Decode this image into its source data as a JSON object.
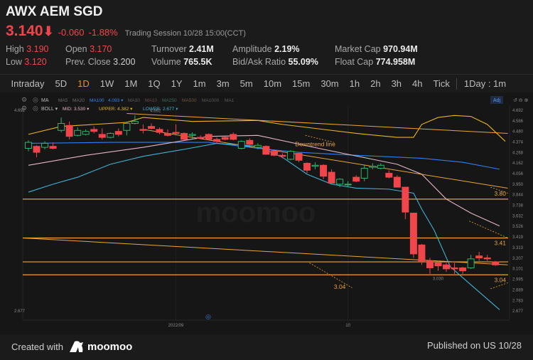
{
  "header": {
    "title": "AWX AEM SGD",
    "price": "3.140",
    "price_arrow_icon": "arrow-down-icon",
    "change": "-0.060",
    "change_pct": "-1.88%",
    "session": "Trading Session  10/28 15:00(CCT)"
  },
  "stats": {
    "high_label": "High",
    "high": "3.190",
    "low_label": "Low",
    "low": "3.120",
    "open_label": "Open",
    "open": "3.170",
    "prev_close_label": "Prev. Close",
    "prev_close": "3.200",
    "turnover_label": "Turnover",
    "turnover": "2.41M",
    "volume_label": "Volume",
    "volume": "765.5K",
    "amplitude_label": "Amplitude",
    "amplitude": "2.19%",
    "bidask_label": "Bid/Ask Ratio",
    "bidask": "55.09%",
    "mktcap_label": "Market Cap",
    "mktcap": "970.94M",
    "floatcap_label": "Float Cap",
    "floatcap": "774.958M"
  },
  "toolbar": {
    "tabs": [
      "Intraday",
      "5D",
      "1D",
      "1W",
      "1M",
      "1Q",
      "1Y",
      "1m",
      "3m",
      "5m",
      "10m",
      "15m",
      "30m",
      "1h",
      "2h",
      "3h",
      "4h",
      "Tick"
    ],
    "active": "1D",
    "interval": "1Day : 1m"
  },
  "indicators": {
    "ma_label": "MA",
    "ma_items": [
      {
        "label": "MA5",
        "color": "#6b6b6b"
      },
      {
        "label": "MA20",
        "color": "#6b6b6b"
      },
      {
        "label": "MA100",
        "color": "#2f86f0",
        "value": "4.093"
      },
      {
        "label": "MA30",
        "color": "#5a5a5a"
      },
      {
        "label": "MA10",
        "color": "#6a4a4a"
      },
      {
        "label": "MA250",
        "color": "#3a6a5a"
      },
      {
        "label": "MA500",
        "color": "#6a5a3a"
      },
      {
        "label": "MA1000",
        "color": "#5a5a5a"
      },
      {
        "label": "MA1",
        "color": "#5a5a5a"
      }
    ],
    "boll_label": "BOLL",
    "mid_label": "MID:",
    "mid": "3.530",
    "upper_label": "UPPER:",
    "upper": "4.382",
    "lower_label": "LOWER:",
    "lower": "2.677",
    "adj_label": "Adj"
  },
  "chart_data": {
    "type": "candlestick",
    "y_ticks": [
      "4.692",
      "4.586",
      "4.480",
      "4.374",
      "4.268",
      "4.162",
      "4.056",
      "3.950",
      "3.844",
      "3.738",
      "3.632",
      "3.526",
      "3.419",
      "3.313",
      "3.207",
      "3.101",
      "2.995",
      "2.889",
      "2.783",
      "2.677"
    ],
    "ylim": [
      2.677,
      4.692
    ],
    "x_labels": [
      {
        "bar": 18,
        "label": "2022/09"
      },
      {
        "bar": 39,
        "label": "10"
      }
    ],
    "colors": {
      "up": "#2fb36b",
      "down": "#f0454a",
      "upper": "#e6b422",
      "mid": "#e3b6c8",
      "lower": "#3fb2d4",
      "ma100": "#2f7ff0",
      "drawing": "#e8a33c"
    },
    "candles": [
      [
        4.31,
        4.39,
        4.28,
        4.37
      ],
      [
        4.33,
        4.34,
        4.22,
        4.27
      ],
      [
        4.32,
        4.38,
        4.3,
        4.36
      ],
      [
        4.33,
        4.37,
        4.3,
        4.31
      ],
      [
        4.49,
        4.62,
        4.47,
        4.56
      ],
      [
        4.54,
        4.58,
        4.4,
        4.43
      ],
      [
        4.44,
        4.52,
        4.43,
        4.49
      ],
      [
        4.45,
        4.5,
        4.44,
        4.48
      ],
      [
        4.5,
        4.53,
        4.46,
        4.48
      ],
      [
        4.45,
        4.51,
        4.4,
        4.42
      ],
      [
        4.42,
        4.47,
        4.41,
        4.46
      ],
      [
        4.48,
        4.51,
        4.43,
        4.45
      ],
      [
        4.49,
        4.58,
        4.44,
        4.56
      ],
      [
        4.56,
        4.64,
        4.55,
        4.58
      ],
      [
        4.5,
        4.55,
        4.46,
        4.49
      ],
      [
        4.53,
        4.56,
        4.5,
        4.51
      ],
      [
        4.5,
        4.52,
        4.45,
        4.47
      ],
      [
        4.46,
        4.5,
        4.43,
        4.44
      ],
      [
        4.47,
        4.55,
        4.44,
        4.46
      ],
      [
        4.46,
        4.47,
        4.39,
        4.4
      ],
      [
        4.44,
        4.47,
        4.4,
        4.45
      ],
      [
        4.42,
        4.44,
        4.4,
        4.41
      ],
      [
        4.45,
        4.46,
        4.39,
        4.4
      ],
      [
        4.4,
        4.42,
        4.36,
        4.38
      ],
      [
        4.42,
        4.43,
        4.39,
        4.4
      ],
      [
        4.45,
        4.47,
        4.39,
        4.4
      ],
      [
        4.31,
        4.39,
        4.3,
        4.38
      ],
      [
        4.39,
        4.41,
        4.34,
        4.35
      ],
      [
        4.32,
        4.36,
        4.3,
        4.34
      ],
      [
        4.33,
        4.34,
        4.25,
        4.25
      ],
      [
        4.28,
        4.3,
        4.23,
        4.24
      ],
      [
        4.24,
        4.26,
        4.21,
        4.23
      ],
      [
        4.2,
        4.29,
        4.19,
        4.28
      ],
      [
        4.26,
        4.27,
        4.17,
        4.19
      ],
      [
        4.16,
        4.17,
        4.06,
        4.09
      ],
      [
        4.13,
        4.17,
        4.1,
        4.14
      ],
      [
        4.14,
        4.15,
        4.0,
        4.03
      ],
      [
        4.07,
        4.1,
        3.96,
        3.96
      ],
      [
        3.95,
        4.01,
        3.92,
        4.0
      ],
      [
        3.95,
        3.98,
        3.92,
        3.95
      ],
      [
        4.02,
        4.04,
        3.97,
        3.98
      ],
      [
        4.01,
        4.14,
        3.98,
        4.11
      ],
      [
        4.12,
        4.16,
        4.1,
        4.13
      ],
      [
        4.11,
        4.16,
        4.1,
        4.14
      ],
      [
        4.06,
        4.09,
        4.01,
        4.02
      ],
      [
        4.02,
        4.04,
        3.92,
        3.92
      ],
      [
        3.92,
        3.92,
        3.6,
        3.67
      ],
      [
        3.66,
        3.66,
        3.21,
        3.25
      ],
      [
        3.34,
        3.35,
        3.14,
        3.18
      ],
      [
        3.18,
        3.21,
        3.05,
        3.11
      ],
      [
        3.16,
        3.18,
        3.08,
        3.13
      ],
      [
        3.14,
        3.16,
        3.07,
        3.1
      ],
      [
        3.11,
        3.16,
        3.05,
        3.1
      ],
      [
        3.11,
        3.12,
        3.05,
        3.08
      ],
      [
        3.11,
        3.24,
        3.1,
        3.2
      ],
      [
        3.23,
        3.27,
        3.18,
        3.21
      ],
      [
        3.21,
        3.24,
        3.18,
        3.2
      ],
      [
        3.17,
        3.18,
        3.13,
        3.14
      ]
    ],
    "lines": {
      "upper": [
        [
          0,
          4.45
        ],
        [
          4,
          4.53
        ],
        [
          8,
          4.55
        ],
        [
          12,
          4.57
        ],
        [
          14,
          4.62
        ],
        [
          20,
          4.58
        ],
        [
          28,
          4.59
        ],
        [
          31,
          4.55
        ],
        [
          36,
          4.5
        ],
        [
          40,
          4.46
        ],
        [
          45,
          4.42
        ],
        [
          47,
          4.42
        ],
        [
          48,
          4.55
        ],
        [
          50,
          4.62
        ],
        [
          52,
          4.64
        ],
        [
          54,
          4.63
        ],
        [
          56,
          4.55
        ],
        [
          58.2,
          4.38
        ]
      ],
      "mid": [
        [
          0,
          4.14
        ],
        [
          7,
          4.24
        ],
        [
          14,
          4.32
        ],
        [
          22,
          4.43
        ],
        [
          28,
          4.44
        ],
        [
          36,
          4.3
        ],
        [
          42,
          4.2
        ],
        [
          45,
          4.15
        ],
        [
          48,
          4.05
        ],
        [
          51,
          3.8
        ],
        [
          54,
          3.66
        ],
        [
          57.5,
          3.53
        ]
      ],
      "lower": [
        [
          0,
          3.87
        ],
        [
          3,
          3.95
        ],
        [
          6,
          4.02
        ],
        [
          10,
          4.15
        ],
        [
          14,
          4.23
        ],
        [
          19,
          4.3
        ],
        [
          23,
          4.36
        ],
        [
          28,
          4.33
        ],
        [
          31,
          4.22
        ],
        [
          34,
          4.05
        ],
        [
          37,
          3.95
        ],
        [
          40,
          3.91
        ],
        [
          44,
          3.9
        ],
        [
          47,
          3.86
        ],
        [
          48,
          3.7
        ],
        [
          49.5,
          3.49
        ],
        [
          51.5,
          3.12
        ],
        [
          54,
          2.94
        ],
        [
          57.5,
          2.69
        ]
      ],
      "ma100": [
        [
          0,
          4.36
        ],
        [
          10,
          4.37
        ],
        [
          22,
          4.37
        ],
        [
          28,
          4.31
        ],
        [
          33,
          4.27
        ],
        [
          40,
          4.24
        ],
        [
          48,
          4.21
        ],
        [
          53,
          4.17
        ],
        [
          57.5,
          4.1
        ]
      ]
    },
    "horizontal_levels": [
      {
        "value": 3.8,
        "label": "3.80"
      },
      {
        "value": 3.41,
        "label": "3.41"
      },
      {
        "value": 3.17,
        "label": ""
      },
      {
        "value": 3.04,
        "label": "3.04"
      }
    ],
    "trend_lines": [
      {
        "from": [
          12,
          4.66
        ],
        "to": [
          58.5,
          4.46
        ],
        "dashed": false
      },
      {
        "from": [
          -0.7,
          3.41
        ],
        "to": [
          58.5,
          3.14
        ],
        "dashed": false
      },
      {
        "from": [
          14,
          4.5
        ],
        "to": [
          58.5,
          3.91
        ],
        "dashed": false
      },
      {
        "from": [
          33.8,
          4.44
        ],
        "to": [
          37.3,
          4.37
        ],
        "dashed": true
      },
      {
        "from": [
          56.4,
          3.92
        ],
        "to": [
          58.5,
          3.86
        ],
        "dashed": true
      },
      {
        "from": [
          53.8,
          3.58
        ],
        "to": [
          58.5,
          3.41
        ],
        "dashed": true
      },
      {
        "from": [
          34.3,
          3.16
        ],
        "to": [
          39.5,
          2.91
        ],
        "dashed": true
      },
      {
        "from": [
          56.4,
          2.9
        ],
        "to": [
          58.5,
          2.96
        ],
        "dashed": true
      }
    ],
    "annotations": [
      {
        "text": "Downtrend line",
        "bar": 35,
        "value": 4.33
      },
      {
        "text": "3.04",
        "bar": 38,
        "value": 2.9
      },
      {
        "text": "3.030",
        "bar": 50,
        "value": 2.99
      },
      {
        "text": "4.692",
        "bar": 15.5,
        "value": 4.675
      }
    ],
    "watermark": "moomoo"
  },
  "footer": {
    "created_with": "Created with",
    "brand": "moomoo",
    "published": "Published on US 10/28"
  }
}
